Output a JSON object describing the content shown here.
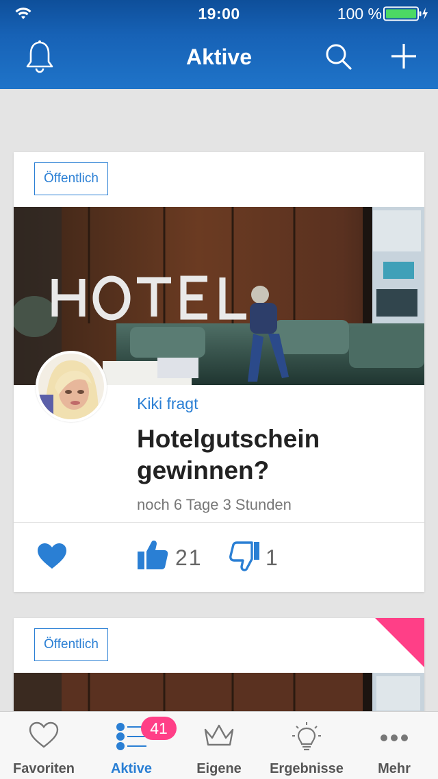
{
  "status_bar": {
    "time": "19:00",
    "battery_percent": "100 %"
  },
  "nav": {
    "title": "Aktive"
  },
  "cards": [
    {
      "visibility": "Öffentlich",
      "author": "Kiki fragt",
      "question": "Hotelgutschein gewinnen?",
      "deadline": "noch 6 Tage 3 Stunden",
      "likes": "21",
      "dislikes": "1"
    },
    {
      "visibility": "Öffentlich"
    }
  ],
  "tabbar": {
    "items": [
      {
        "label": "Favoriten",
        "icon": "heart-outline-icon"
      },
      {
        "label": "Aktive",
        "icon": "list-icon",
        "badge": "41"
      },
      {
        "label": "Eigene",
        "icon": "crown-icon"
      },
      {
        "label": "Ergebnisse",
        "icon": "lightbulb-icon"
      },
      {
        "label": "Mehr",
        "icon": "more-dots-icon"
      }
    ]
  },
  "colors": {
    "accent": "#2a7fd4",
    "header": "#1762b6",
    "badge": "#ff3f87"
  }
}
